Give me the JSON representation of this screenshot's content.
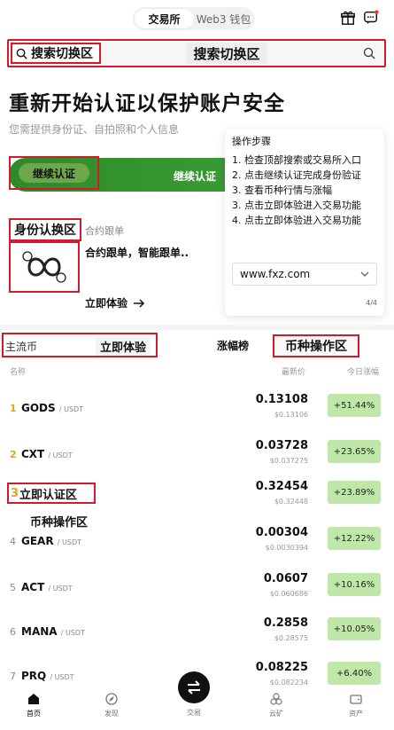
{
  "top_tabs": [
    "交易所",
    "Web3 钱包"
  ],
  "search": {
    "left_label": "搜索切换区",
    "center_label": "搜索切换区"
  },
  "hero": {
    "title": "重新开始认证以保护账户安全",
    "subtitle": "您需提供身份证、自拍照和个人信息",
    "continue_label": "继续认证",
    "continue_right_label": "继续认证"
  },
  "steps": {
    "title": "操作步骤",
    "items": [
      "1. 检查顶部搜索或交易所入口",
      "2. 点击继续认证完成身份验证",
      "3. 查看币种行情与涨幅",
      "3. 点击立即体验进入交易功能",
      "4. 点击立即体验进入交易功能"
    ],
    "url": "www.fxz.com",
    "page": "4/4"
  },
  "identity": {
    "title": "身份认换区",
    "small": "合约跟单",
    "desc": "合约跟单，智能跟单..",
    "try_label": "立即体验"
  },
  "market": {
    "mainstream": "主流币",
    "try_label": "立即体验",
    "gainers": "涨幅榜",
    "coin_op": "币种操作区",
    "col_name": "名称",
    "col_price": "最新价",
    "col_change": "今日涨幅"
  },
  "overlay": {
    "instant_rank": "3",
    "instant_label": "立即认证区",
    "coin_op_label": "币种操作区"
  },
  "rows": [
    {
      "rank": "1",
      "sym": "GODS",
      "unit": "/ USDT",
      "price": "0.13108",
      "sub": "$0.13106",
      "chg": "+51.44%"
    },
    {
      "rank": "2",
      "sym": "CXT",
      "unit": "/ USDT",
      "price": "0.03728",
      "sub": "$0.037275",
      "chg": "+23.65%"
    },
    {
      "rank": "3",
      "sym": "",
      "unit": "",
      "price": "0.32454",
      "sub": "$0.32448",
      "chg": "+23.89%"
    },
    {
      "rank": "4",
      "sym": "GEAR",
      "unit": "/ USDT",
      "price": "0.00304",
      "sub": "$0.0030394",
      "chg": "+12.22%"
    },
    {
      "rank": "5",
      "sym": "ACT",
      "unit": "/ USDT",
      "price": "0.0607",
      "sub": "$0.060686",
      "chg": "+10.16%"
    },
    {
      "rank": "6",
      "sym": "MANA",
      "unit": "/ USDT",
      "price": "0.2858",
      "sub": "$0.28575",
      "chg": "+10.05%"
    },
    {
      "rank": "7",
      "sym": "PRQ",
      "unit": "/ USDT",
      "price": "0.08225",
      "sub": "$0.082234",
      "chg": "+6.40%"
    }
  ],
  "nav": [
    "首页",
    "发现",
    "交易",
    "云矿",
    "资产"
  ],
  "colors": {
    "accent_green": "#2e8a29",
    "gain_bg": "#bfe8a8",
    "highlight_red": "#d01c2a",
    "rank_gold": "#e5a413"
  }
}
